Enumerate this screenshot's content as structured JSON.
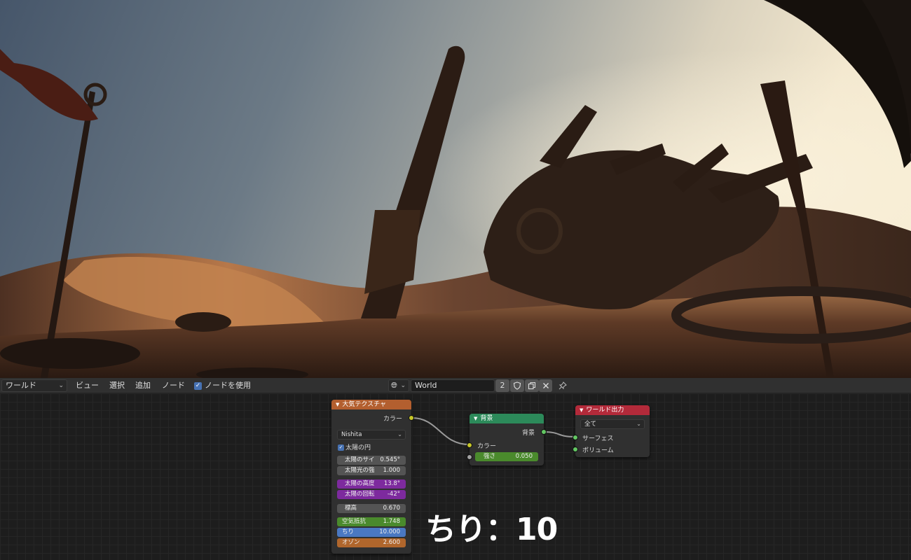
{
  "header": {
    "editor_type": "ワールド",
    "menu": {
      "view": "ビュー",
      "select": "選択",
      "add": "追加",
      "node": "ノード"
    },
    "use_nodes_label": "ノードを使用",
    "use_nodes_checked": true,
    "world_name": "World",
    "user_count": "2"
  },
  "icons": {
    "globe": "globe-icon",
    "shield": "fake-user-shield-icon",
    "duplicate": "duplicate-icon",
    "close": "close-icon",
    "pin": "pin-icon",
    "chevron": "chevron-down-icon",
    "checkbox": "checkmark-icon"
  },
  "nodes": {
    "sky": {
      "title": "大気テクスチャ",
      "output_color": "カラー",
      "sky_type": "Nishita",
      "sun_disc_label": "太陽の円",
      "sun_disc_checked": true,
      "fields": {
        "sun_size": {
          "label": "太陽のサイ",
          "value": "0.545°"
        },
        "sun_intensity": {
          "label": "太陽光の強",
          "value": "1.000"
        },
        "sun_elevation": {
          "label": "太陽の高度",
          "value": "13.8°"
        },
        "sun_rotation": {
          "label": "太陽の回転",
          "value": "-42°"
        },
        "altitude": {
          "label": "標高",
          "value": "0.670"
        },
        "air": {
          "label": "空気抵抗",
          "value": "1.748"
        },
        "dust": {
          "label": "ちり",
          "value": "10.000"
        },
        "ozone": {
          "label": "オゾン",
          "value": "2.600"
        }
      }
    },
    "background": {
      "title": "背景",
      "output": "背景",
      "input_color": "カラー",
      "strength": {
        "label": "強さ",
        "value": "0.050"
      }
    },
    "output": {
      "title": "ワールド出力",
      "target": "全て",
      "surface": "サーフェス",
      "volume": "ボリューム"
    }
  },
  "overlay_text": "ちり：10",
  "colors": {
    "sky_header": "#b35f2f",
    "bg_header": "#2c8a5a",
    "output_header": "#b32a3a",
    "purple_field": "#7d2a9e",
    "green_field": "#4a8a2c",
    "blue_field": "#4a78c2",
    "orange_field": "#b0662c",
    "socket_color": "#c7c729",
    "socket_float": "#a1a1a1",
    "socket_shader": "#63c763"
  }
}
